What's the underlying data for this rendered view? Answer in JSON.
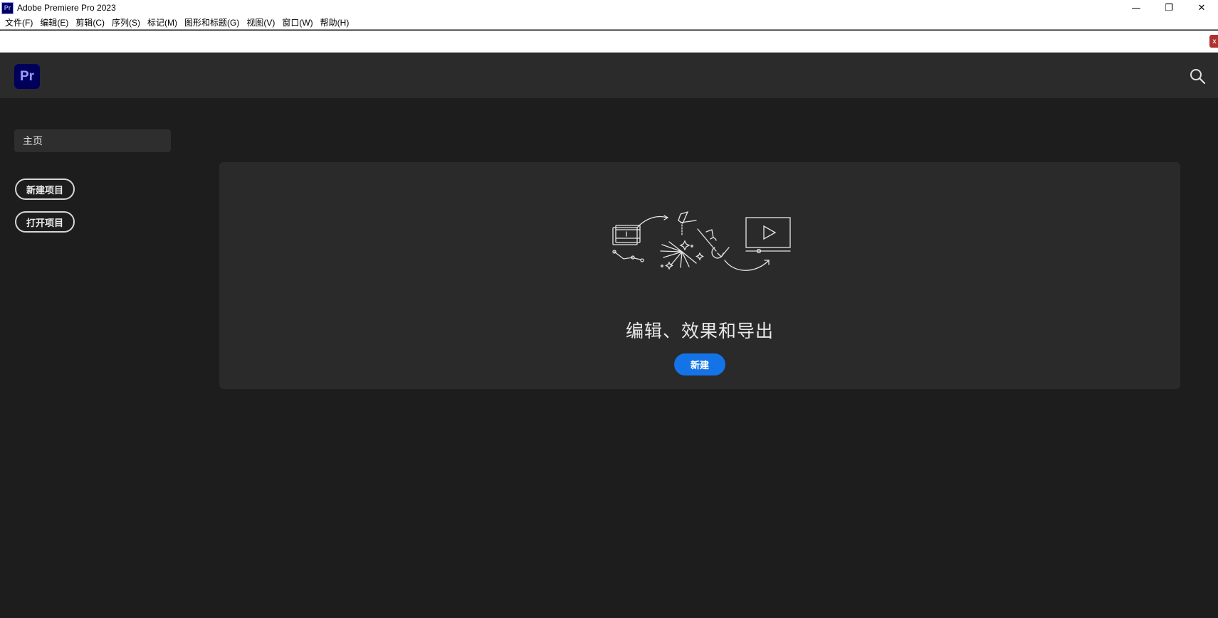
{
  "window": {
    "app_icon_label": "Pr",
    "title": "Adobe Premiere Pro 2023",
    "controls": {
      "minimize": "—",
      "restore": "❐",
      "close": "✕"
    }
  },
  "menubar": {
    "items": [
      "文件(F)",
      "编辑(E)",
      "剪辑(C)",
      "序列(S)",
      "标记(M)",
      "图形和标题(G)",
      "视图(V)",
      "窗口(W)",
      "帮助(H)"
    ]
  },
  "strip": {
    "close_label": "x"
  },
  "header": {
    "logo_label": "Pr",
    "search_icon": "search-icon"
  },
  "sidebar": {
    "home_label": "主页",
    "new_project_label": "新建项目",
    "open_project_label": "打开项目"
  },
  "main": {
    "heading": "编辑、效果和导出",
    "new_button_label": "新建",
    "illustration_icons": [
      "film-clip-icon",
      "sparkle-icon",
      "pen-icon",
      "text-icon",
      "video-monitor-icon"
    ]
  },
  "colors": {
    "background": "#1d1d1d",
    "header": "#2b2b2b",
    "card": "#2a2a2a",
    "accent": "#1473e6",
    "pr_logo_bg": "#00005b",
    "pr_logo_fg": "#9999ff"
  }
}
